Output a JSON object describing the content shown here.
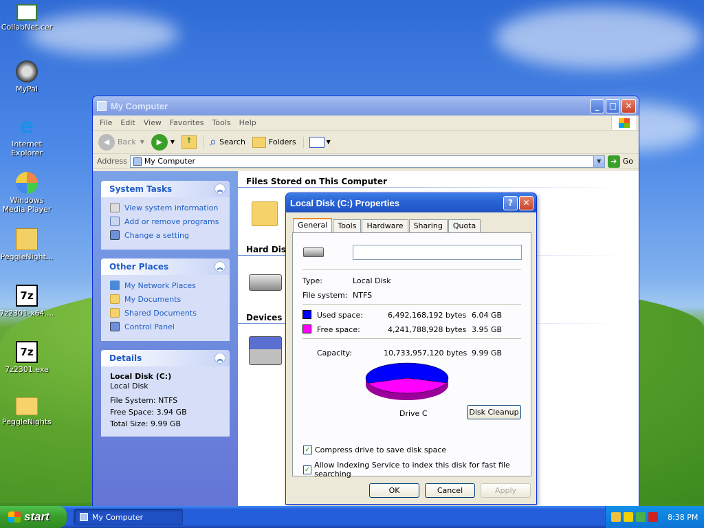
{
  "desktop": {
    "icons": [
      {
        "label": "CollabNet.cer",
        "icon": "certificate-icon"
      },
      {
        "label": "MyPal",
        "icon": "raccoon-shortcut-icon"
      },
      {
        "label": "Internet Explorer",
        "icon": "internet-explorer-icon"
      },
      {
        "label": "Windows Media Player",
        "icon": "media-player-icon"
      },
      {
        "label": "PeggleNight...",
        "icon": "zip-folder-icon"
      },
      {
        "label": "7z2301-x64....",
        "icon": "7zip-installer-icon"
      },
      {
        "label": "7z2301.exe",
        "icon": "7zip-installer-icon"
      },
      {
        "label": "PeggleNights",
        "icon": "folder-icon"
      }
    ]
  },
  "window": {
    "title": "My Computer",
    "menu": [
      "File",
      "Edit",
      "View",
      "Favorites",
      "Tools",
      "Help"
    ],
    "toolbar": {
      "back": "Back",
      "search": "Search",
      "folders": "Folders"
    },
    "address": {
      "label": "Address",
      "value": "My Computer",
      "go": "Go"
    },
    "system_tasks": {
      "title": "System Tasks",
      "items": [
        "View system information",
        "Add or remove programs",
        "Change a setting"
      ]
    },
    "other_places": {
      "title": "Other Places",
      "items": [
        "My Network Places",
        "My Documents",
        "Shared Documents",
        "Control Panel"
      ]
    },
    "details": {
      "title": "Details",
      "name": "Local Disk (C:)",
      "type": "Local Disk",
      "file_system": "File System: NTFS",
      "free_space": "Free Space: 3.94 GB",
      "total_size": "Total Size: 9.99 GB"
    },
    "groups": {
      "files_stored": "Files Stored on This Computer",
      "hard_disk": "Hard Disk",
      "devices": "Devices w"
    }
  },
  "dialog": {
    "title": "Local Disk (C:) Properties",
    "tabs": [
      "General",
      "Tools",
      "Hardware",
      "Sharing",
      "Quota"
    ],
    "active_tab": "General",
    "label_value": "",
    "type_label": "Type:",
    "type_value": "Local Disk",
    "fs_label": "File system:",
    "fs_value": "NTFS",
    "used_label": "Used space:",
    "used_bytes": "6,492,168,192 bytes",
    "used_gb": "6.04 GB",
    "free_label": "Free space:",
    "free_bytes": "4,241,788,928 bytes",
    "free_gb": "3.95 GB",
    "capacity_label": "Capacity:",
    "capacity_bytes": "10,733,957,120 bytes",
    "capacity_gb": "9.99 GB",
    "drive_label": "Drive C",
    "disk_cleanup": "Disk Cleanup",
    "compress_label": "Compress drive to save disk space",
    "index_label": "Allow Indexing Service to index this disk for fast file searching",
    "ok": "OK",
    "cancel": "Cancel",
    "apply": "Apply",
    "used_color": "#0000ff",
    "free_color": "#ff00ff"
  },
  "taskbar": {
    "start": "start",
    "task": "My Computer",
    "clock": "8:38 PM"
  }
}
